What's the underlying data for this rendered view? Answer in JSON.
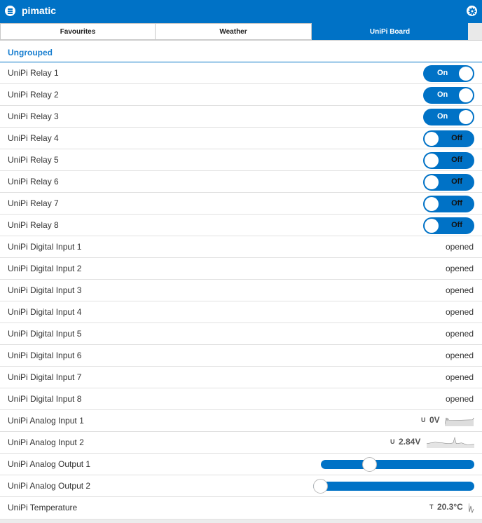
{
  "header": {
    "title": "pimatic",
    "menu_icon": "menu-icon",
    "settings_icon": "gear-icon"
  },
  "tabs": [
    {
      "label": "Favourites",
      "active": false
    },
    {
      "label": "Weather",
      "active": false
    },
    {
      "label": "UniPi Board",
      "active": true
    }
  ],
  "group": {
    "label": "Ungrouped"
  },
  "relays": [
    {
      "label": "UniPi Relay 1",
      "state": "On"
    },
    {
      "label": "UniPi Relay 2",
      "state": "On"
    },
    {
      "label": "UniPi Relay 3",
      "state": "On"
    },
    {
      "label": "UniPi Relay 4",
      "state": "Off"
    },
    {
      "label": "UniPi Relay 5",
      "state": "Off"
    },
    {
      "label": "UniPi Relay 6",
      "state": "Off"
    },
    {
      "label": "UniPi Relay 7",
      "state": "Off"
    },
    {
      "label": "UniPi Relay 8",
      "state": "Off"
    }
  ],
  "digital_inputs": [
    {
      "label": "UniPi Digital Input 1",
      "value": "opened"
    },
    {
      "label": "UniPi Digital Input 2",
      "value": "opened"
    },
    {
      "label": "UniPi Digital Input 3",
      "value": "opened"
    },
    {
      "label": "UniPi Digital Input 4",
      "value": "opened"
    },
    {
      "label": "UniPi Digital Input 5",
      "value": "opened"
    },
    {
      "label": "UniPi Digital Input 6",
      "value": "opened"
    },
    {
      "label": "UniPi Digital Input 7",
      "value": "opened"
    },
    {
      "label": "UniPi Digital Input 8",
      "value": "opened"
    }
  ],
  "analog_inputs": [
    {
      "label": "UniPi Analog Input 1",
      "acronym": "U",
      "value": "0V"
    },
    {
      "label": "UniPi Analog Input 2",
      "acronym": "U",
      "value": "2.84V"
    }
  ],
  "analog_outputs": [
    {
      "label": "UniPi Analog Output 1",
      "level": 0.3
    },
    {
      "label": "UniPi Analog Output 2",
      "level": 0.0
    }
  ],
  "temperature": {
    "label": "UniPi Temperature",
    "acronym": "T",
    "value": "20.3°C"
  },
  "colors": {
    "accent": "#0072c6",
    "group_text": "#1a7fd0"
  }
}
